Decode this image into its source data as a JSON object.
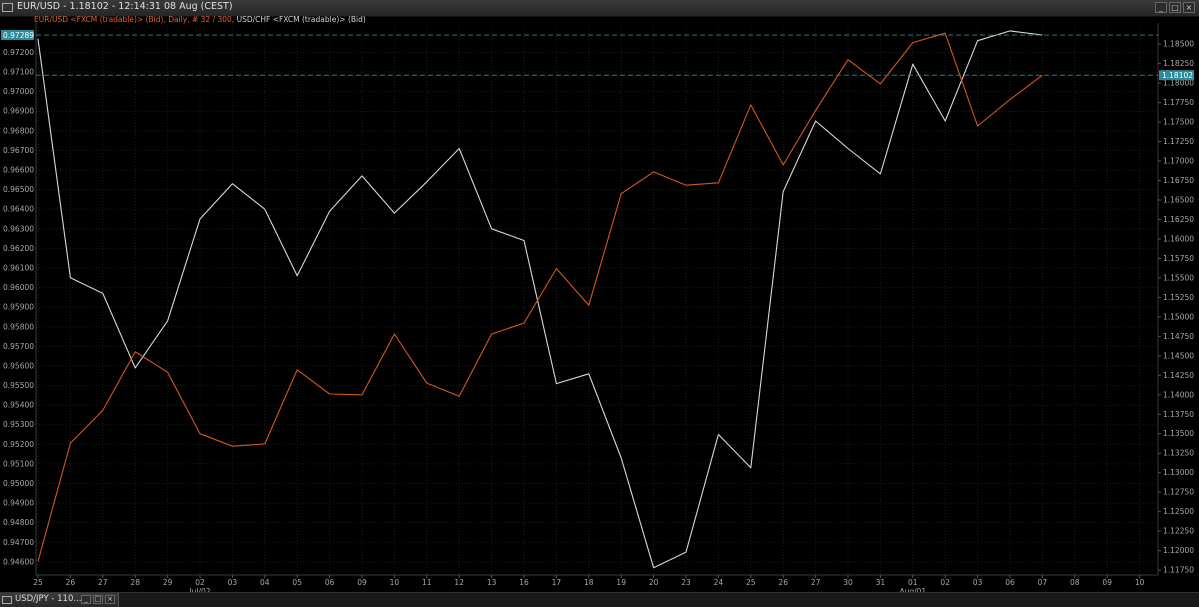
{
  "window": {
    "title": "EUR/USD - 1.18102 - 12:14:31  08 Aug (CEST)",
    "buttons": [
      "_",
      "□",
      "×"
    ]
  },
  "legend": {
    "series1": "EUR/USD <FXCM (tradable)> (Bid), Daily, # 32 / 300,",
    "series2": "USD/CHF <FXCM (tradable)> (Bid)"
  },
  "taskbar": {
    "item": "USD/JPY - 110...",
    "buttons": [
      "_",
      "□",
      "×"
    ]
  },
  "colors": {
    "background": "#000000",
    "grid": "#1e1e1e",
    "eurusd": "#d2581c",
    "usdchf": "#d8d8d8",
    "badge": "#2a8c9c",
    "marker_line": "#2a8c9c"
  },
  "chart_data": {
    "type": "line",
    "x": [
      "25",
      "26",
      "27",
      "28",
      "29",
      "02",
      "03",
      "04",
      "05",
      "06",
      "09",
      "10",
      "11",
      "12",
      "13",
      "16",
      "17",
      "18",
      "19",
      "20",
      "23",
      "24",
      "25",
      "26",
      "27",
      "30",
      "31",
      "01",
      "02",
      "03",
      "06",
      "07",
      "08",
      "09",
      "10"
    ],
    "month_labels": [
      {
        "label": "Jul/02",
        "at": "02"
      },
      {
        "label": "Aug/01",
        "at": "01"
      }
    ],
    "left_axis": {
      "ticks": [
        "0.97200",
        "0.97100",
        "0.97000",
        "0.96900",
        "0.96800",
        "0.96700",
        "0.96600",
        "0.96500",
        "0.96400",
        "0.96300",
        "0.96200",
        "0.96100",
        "0.96000",
        "0.95900",
        "0.95800",
        "0.95700",
        "0.95600",
        "0.95500",
        "0.95400",
        "0.95300",
        "0.95200",
        "0.95100",
        "0.95000",
        "0.94900",
        "0.94800",
        "0.94700",
        "0.94600"
      ],
      "range": [
        0.94538,
        0.9733
      ]
    },
    "right_axis": {
      "ticks": [
        "1.18500",
        "1.18250",
        "1.18000",
        "1.17750",
        "1.17500",
        "1.17250",
        "1.17000",
        "1.16750",
        "1.16500",
        "1.16250",
        "1.16000",
        "1.15750",
        "1.15500",
        "1.15250",
        "1.15000",
        "1.14750",
        "1.14500",
        "1.14250",
        "1.14000",
        "1.13750",
        "1.13500",
        "1.13250",
        "1.13000",
        "1.12750",
        "1.12500",
        "1.12250",
        "1.12000",
        "1.11750"
      ],
      "range": [
        1.117,
        1.1872
      ]
    },
    "series": [
      {
        "name": "USD/CHF",
        "axis": "left",
        "values": [
          0.9727,
          0.9605,
          0.9597,
          0.9559,
          0.9583,
          0.9635,
          0.9653,
          0.964,
          0.9606,
          0.9639,
          0.9657,
          0.9638,
          0.9654,
          0.9671,
          0.963,
          0.9624,
          0.9551,
          0.9556,
          0.9513,
          0.9457,
          0.9465,
          0.9525,
          0.9508,
          0.9649,
          0.9685,
          0.9671,
          0.9658,
          0.9714,
          0.9685,
          0.9726,
          0.9731,
          0.97289
        ]
      },
      {
        "name": "EUR/USD",
        "axis": "right",
        "values": [
          1.1186,
          1.1338,
          1.138,
          1.1455,
          1.1429,
          1.135,
          1.1334,
          1.1337,
          1.1432,
          1.1401,
          1.14,
          1.1478,
          1.1415,
          1.1398,
          1.1478,
          1.1492,
          1.1562,
          1.1515,
          1.1658,
          1.1686,
          1.1669,
          1.1672,
          1.1772,
          1.1695,
          1.1765,
          1.183,
          1.1799,
          1.1852,
          1.1864,
          1.1745,
          1.1779,
          1.18102
        ]
      }
    ],
    "last_values": {
      "left": "0.97289",
      "right": "1.18102"
    }
  }
}
